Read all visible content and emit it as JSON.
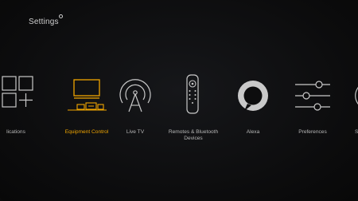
{
  "header": {
    "title": "Settings"
  },
  "colors": {
    "accent": "#f0a500",
    "text": "#b7b7b7",
    "icon": "#c9c9c9"
  },
  "menu": {
    "items": [
      {
        "label": "lications",
        "icon": "apps-grid-icon",
        "active": false
      },
      {
        "label": "Equipment Control",
        "icon": "equipment-control-icon",
        "active": true
      },
      {
        "label": "Live TV",
        "icon": "antenna-icon",
        "active": false
      },
      {
        "label": "Remotes & Bluetooth Devices",
        "icon": "remote-icon",
        "active": false
      },
      {
        "label": "Alexa",
        "icon": "alexa-ring-icon",
        "active": false
      },
      {
        "label": "Preferences",
        "icon": "sliders-icon",
        "active": false
      },
      {
        "label": "S",
        "icon": "system-icon",
        "active": false
      }
    ]
  }
}
